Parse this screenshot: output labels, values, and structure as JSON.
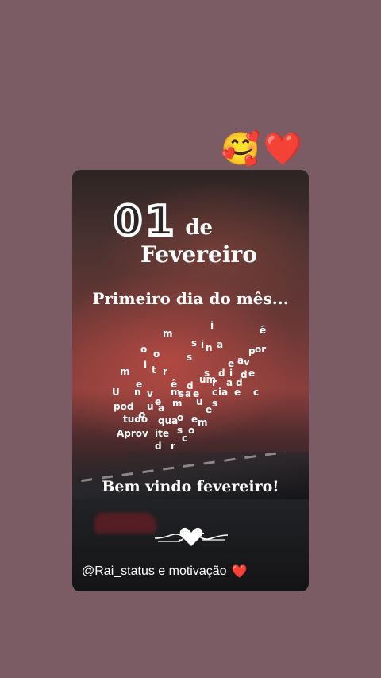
{
  "sticker": {
    "hug_emoji": "🥰",
    "heart_emoji": "❤️"
  },
  "card": {
    "day": "01",
    "de": "de",
    "month": "Fevereiro",
    "first_day": "Primeiro dia do mês...",
    "scatter_words": [
      "Um",
      "novo",
      "mês",
      "se",
      "inicia",
      "e",
      "com",
      "ele",
      "podemos",
      "realizar",
      "tudo",
      "aquilo",
      "que",
      "sonhamos",
      "Aproveite",
      "cada",
      "dia",
      "dia",
      "a",
      "por"
    ],
    "welcome": "Bem vindo fevereiro!",
    "credit": "@Rai_status e motivação",
    "credit_heart": "❤️"
  },
  "colors": {
    "background": "#7b5c64",
    "credit_heart": "#e23b3b"
  },
  "icons": [
    "hug-emoji-icon",
    "red-heart-icon",
    "heart-divider-icon"
  ]
}
